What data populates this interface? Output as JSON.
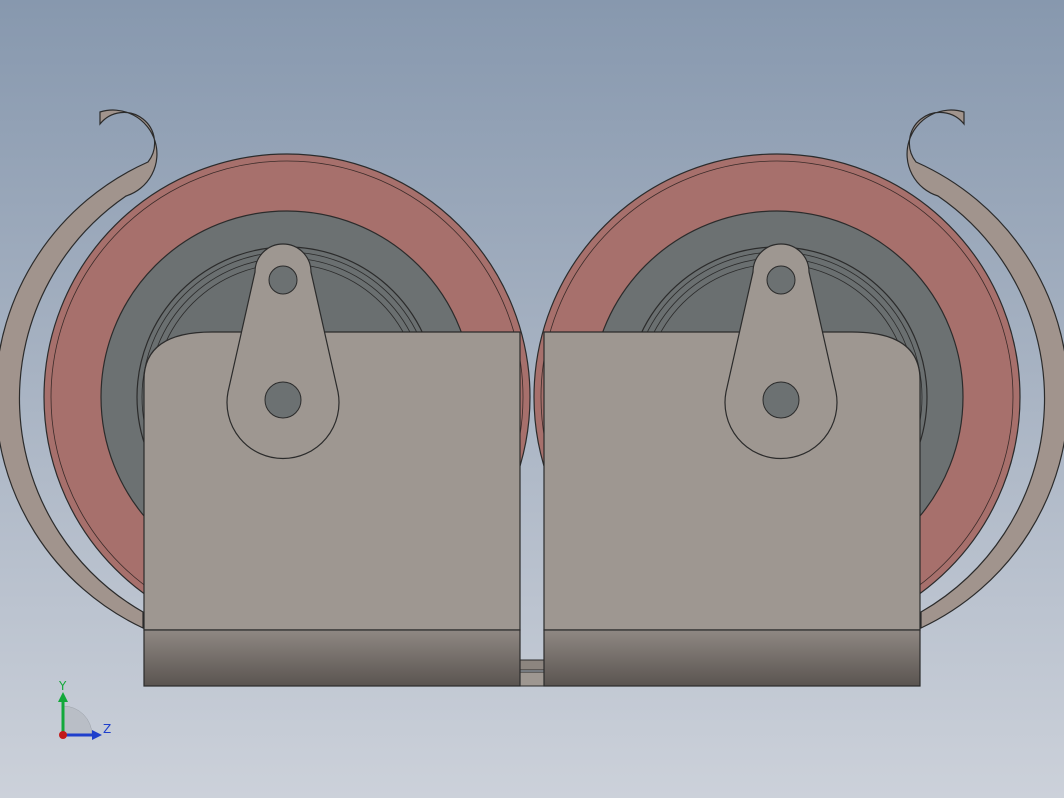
{
  "colors": {
    "background_top": "#8798ae",
    "background_bottom": "#ccd1da",
    "tire": "#a7706c",
    "hub": "#6c7172",
    "bracket": "#9e9791",
    "bracket_dark": "#5f5955",
    "outline": "#2b2b2b",
    "axis_y": "#12a83a",
    "axis_z": "#1f3fcc",
    "axis_origin": "#c21a1a"
  },
  "view": {
    "orientation": "axis-triad"
  },
  "triad": {
    "y_label": "Y",
    "z_label": "Z"
  }
}
